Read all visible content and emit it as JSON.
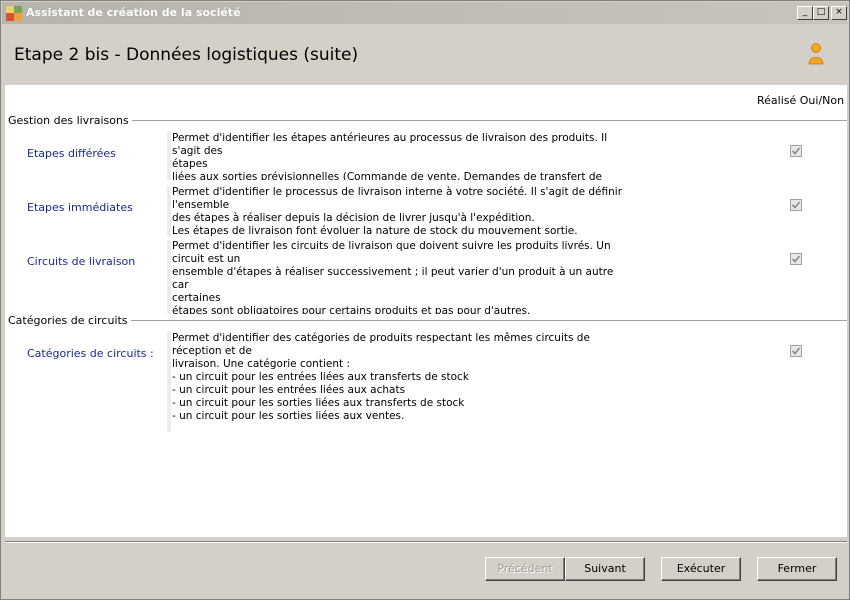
{
  "window": {
    "title": "Assistant de création de la société",
    "controls": {
      "minimize": "_",
      "maximize": "□",
      "close": "×"
    }
  },
  "header": {
    "step_title": "Etape 2 bis - Données logistiques (suite)",
    "icon": "user-icon"
  },
  "columns": {
    "done_header": "Réalisé Oui/Non"
  },
  "sections": [
    {
      "title": "Gestion des livraisons",
      "items": [
        {
          "label": "Etapes différées",
          "description": "Permet d'identifier les étapes antérieures au processus de livraison des produits. Il s'agit des\nétapes\nliées aux sorties prévisionnelles (Commande de vente, Demandes de transfert de stock, ...).",
          "done": true
        },
        {
          "label": "Etapes immédiates",
          "description": "Permet d'identifier le processus de livraison interne à votre société. Il s'agit de définir\nl'ensemble\ndes étapes à réaliser depuis la décision de livrer jusqu'à l'expédition.\nLes étapes de livraison font évoluer la nature de stock du mouvement sortie.",
          "done": true
        },
        {
          "label": "Circuits de livraison",
          "description": "Permet d'identifier les circuits de livraison que doivent suivre les produits livrés. Un circuit est un\nensemble d'étapes à réaliser successivement ; il peut varier d'un produit à un autre car\ncertaines\nétapes sont obligatoires pour certains produits et pas pour d'autres.",
          "done": true
        }
      ]
    },
    {
      "title": "Catégories de circuits",
      "items": [
        {
          "label": "Catégories de circuits :",
          "description": "Permet d'identifier des catégories de produits respectant les mêmes circuits de réception et de\nlivraison. Une catégorie contient :\n- un circuit pour les entrées liées aux transferts de stock\n- un circuit pour les entrées liées aux achats\n- un circuit pour les sorties liées aux transferts de stock\n- un circuit pour les sorties liées aux ventes.",
          "done": true
        }
      ]
    }
  ],
  "buttons": {
    "previous": "Précédent",
    "next": "Suivant",
    "execute": "Exécuter",
    "close": "Fermer"
  },
  "colors": {
    "titlebar": "#b8b4ac",
    "link_label": "#1a2a8c",
    "background": "#d4d0c8"
  }
}
